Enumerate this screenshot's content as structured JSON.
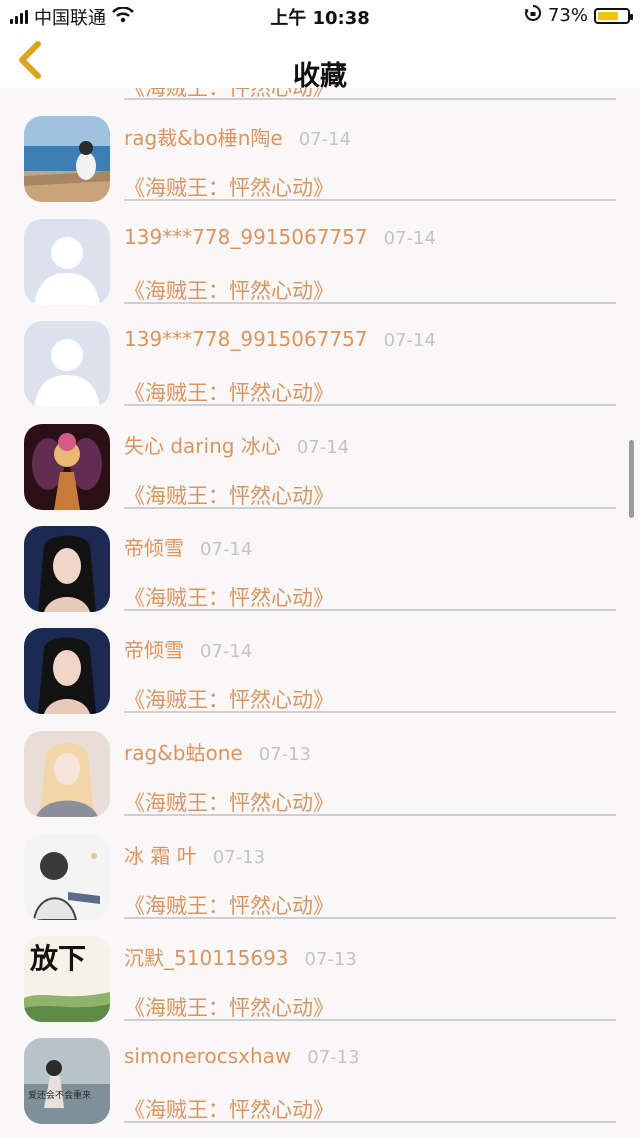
{
  "status_bar": {
    "carrier": "中国联通",
    "time": "上午 10:38",
    "battery_percent": "73%",
    "battery_level": 0.73,
    "wifi_icon": "wifi-icon",
    "orientation_icon": "orientation-lock-icon"
  },
  "nav": {
    "title": "收藏",
    "back_icon": "chevron-left-icon"
  },
  "colors": {
    "accent": "#d9955f",
    "date": "#c4c4c4",
    "background": "#faf7f9",
    "back_chevron": "#d9a51b"
  },
  "partial_top_item": {
    "title": "《海贼王：怦然心动》"
  },
  "favorites": [
    {
      "user": "rag裁&bo棰n陶e",
      "date": "07-14",
      "title": "《海贼王：怦然心动》",
      "avatar": "seaside-girl"
    },
    {
      "user": "139***778_9915067757",
      "date": "07-14",
      "title": "《海贼王：怦然心动》",
      "avatar": "default-silhouette"
    },
    {
      "user": "139***778_9915067757",
      "date": "07-14",
      "title": "《海贼王：怦然心动》",
      "avatar": "default-silhouette"
    },
    {
      "user": "失心 daring 冰心",
      "date": "07-14",
      "title": "《海贼王：怦然心动》",
      "avatar": "fairy-girl"
    },
    {
      "user": "帝倾雪",
      "date": "07-14",
      "title": "《海贼王：怦然心动》",
      "avatar": "woman-portrait"
    },
    {
      "user": "帝倾雪",
      "date": "07-14",
      "title": "《海贼王：怦然心动》",
      "avatar": "woman-portrait"
    },
    {
      "user": "rag&b蛄one",
      "date": "07-13",
      "title": "《海贼王：怦然心动》",
      "avatar": "blonde-girl"
    },
    {
      "user": "冰 霜 叶",
      "date": "07-13",
      "title": "《海贼王：怦然心动》",
      "avatar": "sketch-boy"
    },
    {
      "user": "沉默_510115693",
      "date": "07-13",
      "title": "《海贼王：怦然心动》",
      "avatar": "calligraphy-landscape",
      "avatar_text": "放下"
    },
    {
      "user": "simonerocsxhaw",
      "date": "07-13",
      "title": "《海贼王：怦然心动》",
      "avatar": "sea-girl",
      "avatar_text": "爱还会不会重来"
    }
  ]
}
